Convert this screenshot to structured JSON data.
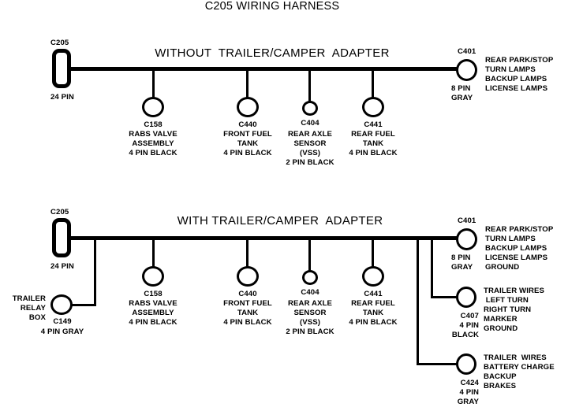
{
  "diagram": {
    "title": "C205 WIRING HARNESS",
    "sections": [
      {
        "heading": "WITHOUT  TRAILER/CAMPER  ADAPTER",
        "source": {
          "id": "C205",
          "pins": "24 PIN"
        },
        "endpoint": {
          "id": "C401",
          "pins": "8 PIN",
          "color": "GRAY",
          "functions": [
            "REAR PARK/STOP",
            "TURN LAMPS",
            "BACKUP LAMPS",
            "LICENSE LAMPS"
          ]
        },
        "branches": [
          {
            "id": "C158",
            "name_line1": "RABS VALVE",
            "name_line2": "ASSEMBLY",
            "name_line3": "",
            "spec": "4 PIN BLACK"
          },
          {
            "id": "C440",
            "name_line1": "FRONT FUEL",
            "name_line2": "TANK",
            "name_line3": "",
            "spec": "4 PIN BLACK"
          },
          {
            "id": "C404",
            "name_line1": "REAR AXLE",
            "name_line2": "SENSOR",
            "name_line3": "(VSS)",
            "spec": "2 PIN BLACK"
          },
          {
            "id": "C441",
            "name_line1": "REAR FUEL",
            "name_line2": "TANK",
            "name_line3": "",
            "spec": "4 PIN BLACK"
          }
        ]
      },
      {
        "heading": "WITH TRAILER/CAMPER  ADAPTER",
        "source": {
          "id": "C205",
          "pins": "24 PIN"
        },
        "relay": {
          "name_line1": "TRAILER",
          "name_line2": "RELAY",
          "name_line3": "BOX",
          "id": "C149",
          "spec": "4 PIN GRAY"
        },
        "endpoint": {
          "id": "C401",
          "pins": "8 PIN",
          "color": "GRAY",
          "functions": [
            "REAR PARK/STOP",
            "TURN LAMPS",
            "BACKUP LAMPS",
            "LICENSE LAMPS",
            "GROUND"
          ]
        },
        "branches": [
          {
            "id": "C158",
            "name_line1": "RABS VALVE",
            "name_line2": "ASSEMBLY",
            "name_line3": "",
            "spec": "4 PIN BLACK"
          },
          {
            "id": "C440",
            "name_line1": "FRONT FUEL",
            "name_line2": "TANK",
            "name_line3": "",
            "spec": "4 PIN BLACK"
          },
          {
            "id": "C404",
            "name_line1": "REAR AXLE",
            "name_line2": "SENSOR",
            "name_line3": "(VSS)",
            "spec": "2 PIN BLACK"
          },
          {
            "id": "C441",
            "name_line1": "REAR FUEL",
            "name_line2": "TANK",
            "name_line3": "",
            "spec": "4 PIN BLACK"
          }
        ],
        "trailer_connectors": [
          {
            "id": "C407",
            "pins": "4 PIN",
            "color": "BLACK",
            "functions": [
              "TRAILER WIRES",
              " LEFT TURN",
              "RIGHT TURN",
              "MARKER",
              "GROUND"
            ]
          },
          {
            "id": "C424",
            "pins": "4 PIN",
            "color": "GRAY",
            "functions": [
              "TRAILER  WIRES",
              "BATTERY CHARGE",
              "BACKUP",
              "BRAKES"
            ]
          }
        ]
      }
    ]
  }
}
